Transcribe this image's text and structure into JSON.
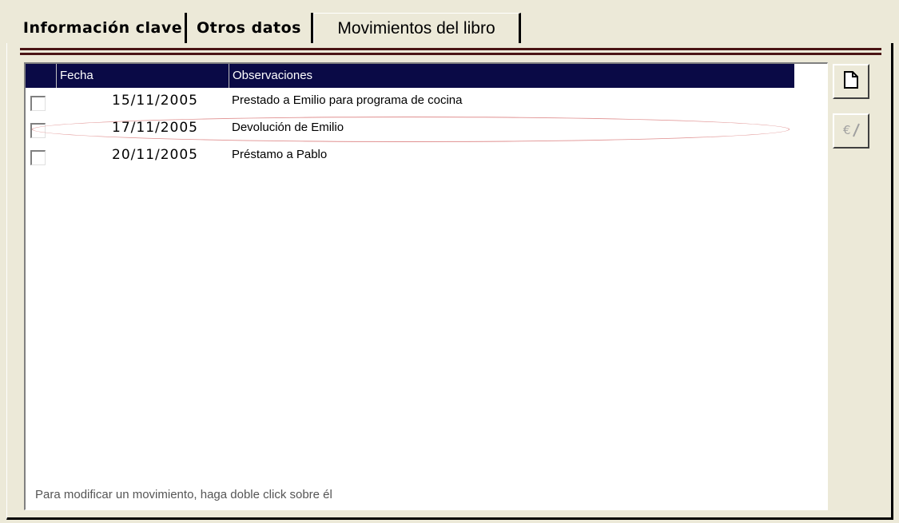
{
  "tabs": [
    {
      "label": "Información clave"
    },
    {
      "label": "Otros datos"
    },
    {
      "label": "Movimientos del libro"
    }
  ],
  "list": {
    "columns": [
      "Fecha",
      "Observaciones"
    ],
    "rows": [
      {
        "date": "15/11/2005",
        "note": "Prestado a Emilio para programa de cocina"
      },
      {
        "date": "17/11/2005",
        "note": "Devolución de Emilio"
      },
      {
        "date": "20/11/2005",
        "note": "Préstamo a Pablo"
      }
    ],
    "hint": "Para modificar un movimiento, haga doble click sobre él"
  },
  "buttons": {
    "new_icon": "new-document-icon",
    "edit_icon": "edit-icon"
  },
  "colors": {
    "accent_line": "#4a1414",
    "header_bg": "#0a0a46",
    "highlight_ellipse": "#e09090"
  }
}
